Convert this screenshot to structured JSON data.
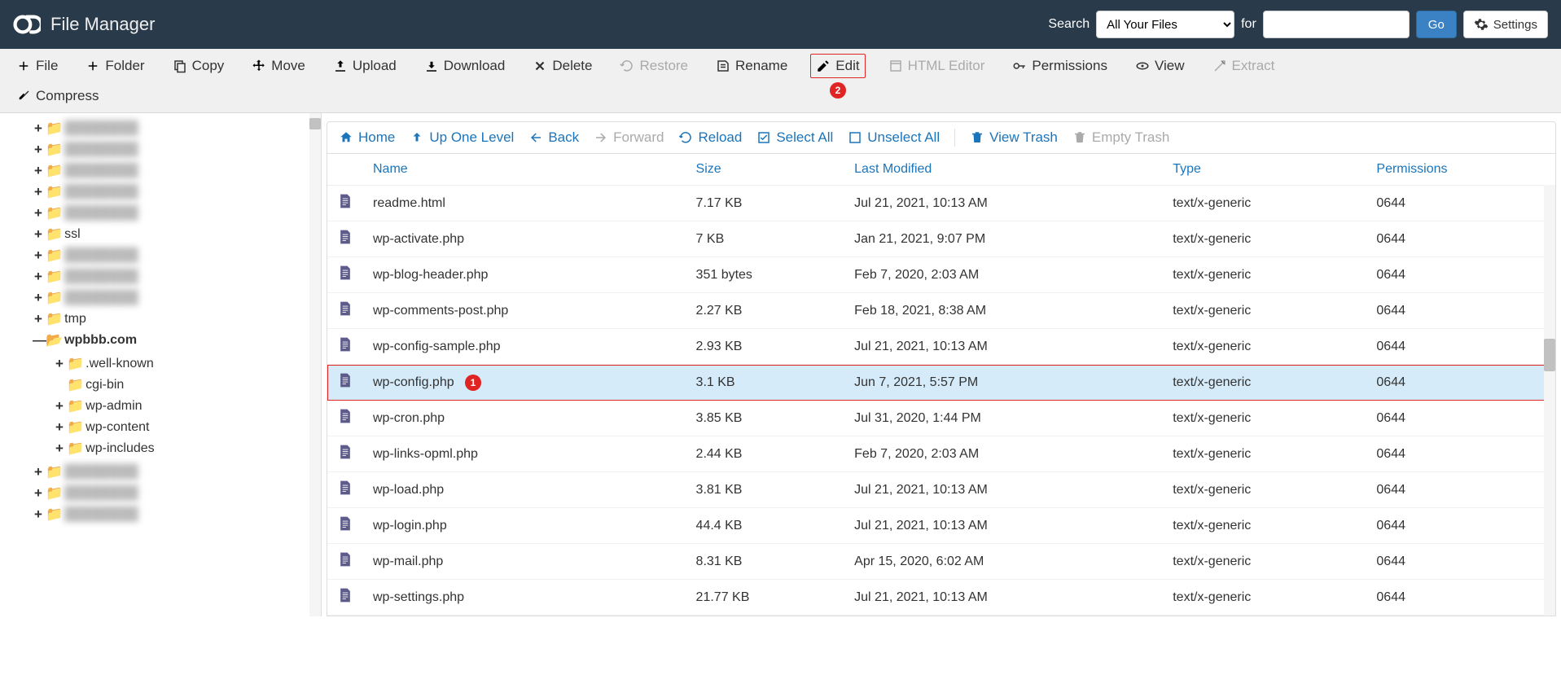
{
  "app": {
    "title": "File Manager"
  },
  "search": {
    "label": "Search",
    "scope": "All Your Files",
    "for_label": "for",
    "go": "Go",
    "settings": "Settings"
  },
  "toolbar": {
    "file": "File",
    "folder": "Folder",
    "copy": "Copy",
    "move": "Move",
    "upload": "Upload",
    "download": "Download",
    "delete": "Delete",
    "restore": "Restore",
    "rename": "Rename",
    "edit": "Edit",
    "html_editor": "HTML Editor",
    "permissions": "Permissions",
    "view": "View",
    "extract": "Extract",
    "compress": "Compress"
  },
  "badges": {
    "edit": "2",
    "selected_row": "1"
  },
  "actions": {
    "home": "Home",
    "up": "Up One Level",
    "back": "Back",
    "forward": "Forward",
    "reload": "Reload",
    "select_all": "Select All",
    "unselect_all": "Unselect All",
    "view_trash": "View Trash",
    "empty_trash": "Empty Trash"
  },
  "tree": {
    "blurred_top_count": 8,
    "ssl": "ssl",
    "tmp": "tmp",
    "main": "wpbbb.com",
    "children": {
      "well_known": ".well-known",
      "cgi_bin": "cgi-bin",
      "wp_admin": "wp-admin",
      "wp_content": "wp-content",
      "wp_includes": "wp-includes"
    },
    "blurred_bottom_count": 3
  },
  "columns": {
    "name": "Name",
    "size": "Size",
    "last_modified": "Last Modified",
    "type": "Type",
    "permissions": "Permissions"
  },
  "files": [
    {
      "name": "readme.html",
      "size": "7.17 KB",
      "modified": "Jul 21, 2021, 10:13 AM",
      "type": "text/x-generic",
      "perm": "0644",
      "selected": false
    },
    {
      "name": "wp-activate.php",
      "size": "7 KB",
      "modified": "Jan 21, 2021, 9:07 PM",
      "type": "text/x-generic",
      "perm": "0644",
      "selected": false
    },
    {
      "name": "wp-blog-header.php",
      "size": "351 bytes",
      "modified": "Feb 7, 2020, 2:03 AM",
      "type": "text/x-generic",
      "perm": "0644",
      "selected": false
    },
    {
      "name": "wp-comments-post.php",
      "size": "2.27 KB",
      "modified": "Feb 18, 2021, 8:38 AM",
      "type": "text/x-generic",
      "perm": "0644",
      "selected": false
    },
    {
      "name": "wp-config-sample.php",
      "size": "2.93 KB",
      "modified": "Jul 21, 2021, 10:13 AM",
      "type": "text/x-generic",
      "perm": "0644",
      "selected": false
    },
    {
      "name": "wp-config.php",
      "size": "3.1 KB",
      "modified": "Jun 7, 2021, 5:57 PM",
      "type": "text/x-generic",
      "perm": "0644",
      "selected": true
    },
    {
      "name": "wp-cron.php",
      "size": "3.85 KB",
      "modified": "Jul 31, 2020, 1:44 PM",
      "type": "text/x-generic",
      "perm": "0644",
      "selected": false
    },
    {
      "name": "wp-links-opml.php",
      "size": "2.44 KB",
      "modified": "Feb 7, 2020, 2:03 AM",
      "type": "text/x-generic",
      "perm": "0644",
      "selected": false
    },
    {
      "name": "wp-load.php",
      "size": "3.81 KB",
      "modified": "Jul 21, 2021, 10:13 AM",
      "type": "text/x-generic",
      "perm": "0644",
      "selected": false
    },
    {
      "name": "wp-login.php",
      "size": "44.4 KB",
      "modified": "Jul 21, 2021, 10:13 AM",
      "type": "text/x-generic",
      "perm": "0644",
      "selected": false
    },
    {
      "name": "wp-mail.php",
      "size": "8.31 KB",
      "modified": "Apr 15, 2020, 6:02 AM",
      "type": "text/x-generic",
      "perm": "0644",
      "selected": false
    },
    {
      "name": "wp-settings.php",
      "size": "21.77 KB",
      "modified": "Jul 21, 2021, 10:13 AM",
      "type": "text/x-generic",
      "perm": "0644",
      "selected": false
    }
  ]
}
